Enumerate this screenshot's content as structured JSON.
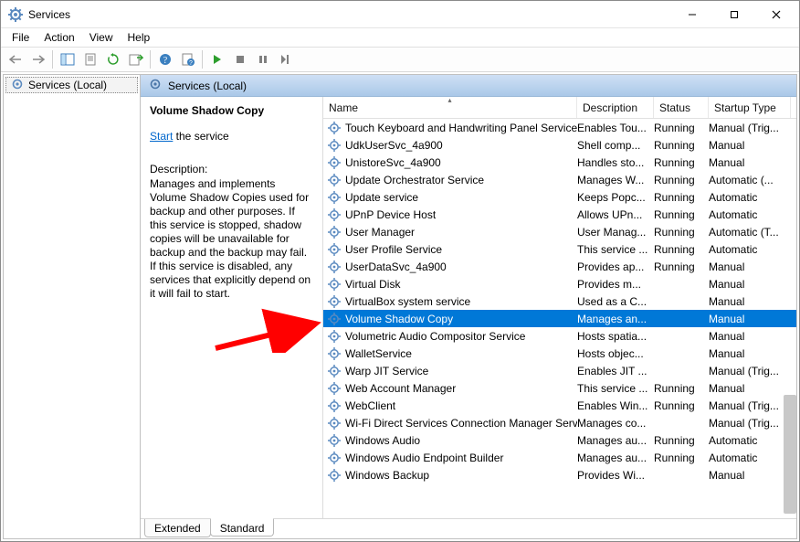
{
  "titlebar": {
    "title": "Services"
  },
  "menubar": {
    "items": [
      "File",
      "Action",
      "View",
      "Help"
    ]
  },
  "toolbar": {
    "buttons": [
      {
        "name": "back-icon"
      },
      {
        "name": "forward-icon"
      },
      {
        "sep": true
      },
      {
        "name": "show-hide-tree-icon"
      },
      {
        "name": "properties-icon"
      },
      {
        "name": "refresh-icon"
      },
      {
        "name": "export-icon"
      },
      {
        "sep": true
      },
      {
        "name": "help-icon"
      },
      {
        "name": "help-topics-icon"
      },
      {
        "sep": true
      },
      {
        "name": "start-service-icon"
      },
      {
        "name": "stop-service-icon"
      },
      {
        "name": "pause-service-icon"
      },
      {
        "name": "restart-service-icon"
      }
    ]
  },
  "tree": {
    "root_label": "Services (Local)"
  },
  "pane_header": {
    "label": "Services (Local)"
  },
  "detail": {
    "selected_name": "Volume Shadow Copy",
    "start_link": "Start",
    "start_suffix": " the service",
    "description_label": "Description:",
    "description_text": "Manages and implements Volume Shadow Copies used for backup and other purposes. If this service is stopped, shadow copies will be unavailable for backup and the backup may fail. If this service is disabled, any services that explicitly depend on it will fail to start."
  },
  "columns": {
    "name": "Name",
    "description": "Description",
    "status": "Status",
    "startup": "Startup Type"
  },
  "services": [
    {
      "name": "Touch Keyboard and Handwriting Panel Service",
      "desc": "Enables Tou...",
      "status": "Running",
      "startup": "Manual (Trig..."
    },
    {
      "name": "UdkUserSvc_4a900",
      "desc": "Shell comp...",
      "status": "Running",
      "startup": "Manual"
    },
    {
      "name": "UnistoreSvc_4a900",
      "desc": "Handles sto...",
      "status": "Running",
      "startup": "Manual"
    },
    {
      "name": "Update Orchestrator Service",
      "desc": "Manages W...",
      "status": "Running",
      "startup": "Automatic (..."
    },
    {
      "name": "Update service",
      "desc": "Keeps Popc...",
      "status": "Running",
      "startup": "Automatic"
    },
    {
      "name": "UPnP Device Host",
      "desc": "Allows UPn...",
      "status": "Running",
      "startup": "Automatic"
    },
    {
      "name": "User Manager",
      "desc": "User Manag...",
      "status": "Running",
      "startup": "Automatic (T..."
    },
    {
      "name": "User Profile Service",
      "desc": "This service ...",
      "status": "Running",
      "startup": "Automatic"
    },
    {
      "name": "UserDataSvc_4a900",
      "desc": "Provides ap...",
      "status": "Running",
      "startup": "Manual"
    },
    {
      "name": "Virtual Disk",
      "desc": "Provides m...",
      "status": "",
      "startup": "Manual"
    },
    {
      "name": "VirtualBox system service",
      "desc": "Used as a C...",
      "status": "",
      "startup": "Manual"
    },
    {
      "name": "Volume Shadow Copy",
      "desc": "Manages an...",
      "status": "",
      "startup": "Manual",
      "selected": true
    },
    {
      "name": "Volumetric Audio Compositor Service",
      "desc": "Hosts spatia...",
      "status": "",
      "startup": "Manual"
    },
    {
      "name": "WalletService",
      "desc": "Hosts objec...",
      "status": "",
      "startup": "Manual"
    },
    {
      "name": "Warp JIT Service",
      "desc": "Enables JIT ...",
      "status": "",
      "startup": "Manual (Trig..."
    },
    {
      "name": "Web Account Manager",
      "desc": "This service ...",
      "status": "Running",
      "startup": "Manual"
    },
    {
      "name": "WebClient",
      "desc": "Enables Win...",
      "status": "Running",
      "startup": "Manual (Trig..."
    },
    {
      "name": "Wi-Fi Direct Services Connection Manager Serv...",
      "desc": "Manages co...",
      "status": "",
      "startup": "Manual (Trig..."
    },
    {
      "name": "Windows Audio",
      "desc": "Manages au...",
      "status": "Running",
      "startup": "Automatic"
    },
    {
      "name": "Windows Audio Endpoint Builder",
      "desc": "Manages au...",
      "status": "Running",
      "startup": "Automatic"
    },
    {
      "name": "Windows Backup",
      "desc": "Provides Wi...",
      "status": "",
      "startup": "Manual"
    }
  ],
  "tabs": {
    "extended": "Extended",
    "standard": "Standard"
  }
}
